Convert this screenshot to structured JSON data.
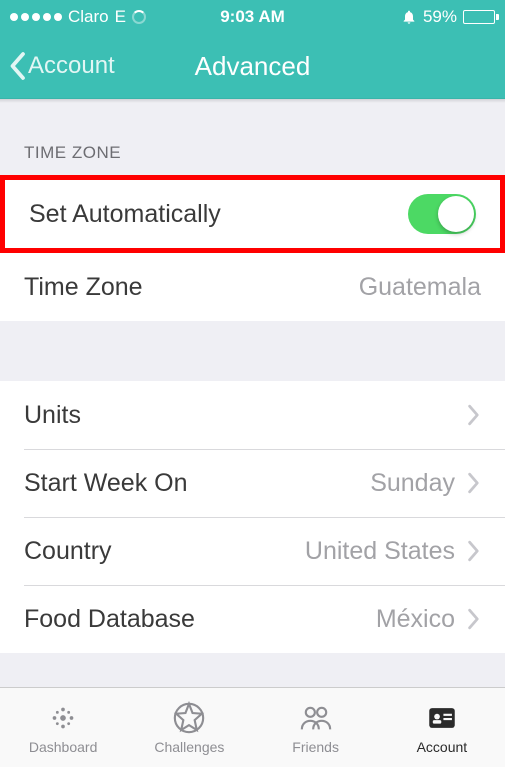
{
  "status_bar": {
    "carrier": "Claro",
    "network": "E",
    "time": "9:03 AM",
    "battery_percent": "59%"
  },
  "nav": {
    "back_label": "Account",
    "title": "Advanced"
  },
  "sections": {
    "timezone_header": "TIME ZONE",
    "set_auto_label": "Set Automatically",
    "set_auto_on": true,
    "timezone_label": "Time Zone",
    "timezone_value": "Guatemala",
    "units_label": "Units",
    "start_week_label": "Start Week On",
    "start_week_value": "Sunday",
    "country_label": "Country",
    "country_value": "United States",
    "food_db_label": "Food Database",
    "food_db_value": "México"
  },
  "tabs": {
    "dashboard": "Dashboard",
    "challenges": "Challenges",
    "friends": "Friends",
    "account": "Account"
  }
}
